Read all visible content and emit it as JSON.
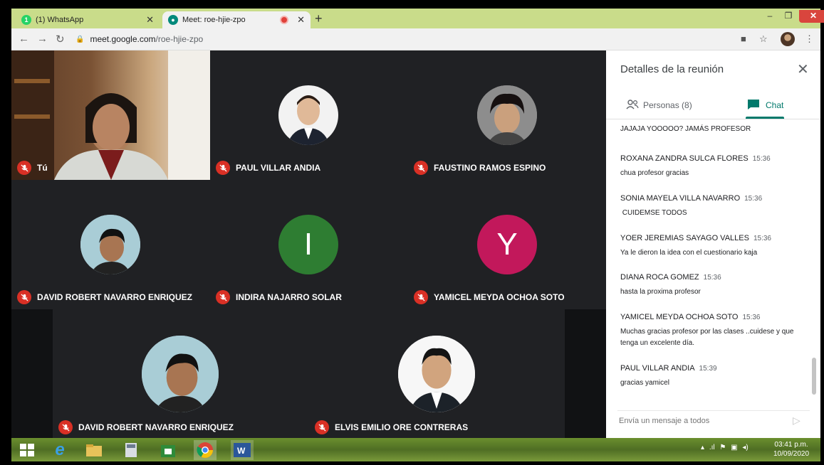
{
  "browser": {
    "tabs": [
      {
        "title": "(1) WhatsApp",
        "favicon": "whatsapp-icon",
        "badge": "1"
      },
      {
        "title": "Meet: roe-hjie-zpo",
        "favicon": "meet-icon"
      }
    ],
    "url_host": "meet.google.com",
    "url_path": "/roe-hjie-zpo",
    "accent": "#c9dc8a"
  },
  "stage": {
    "self_label": "Tú",
    "tiles": [
      {
        "name": "PAUL VILLAR ANDIA"
      },
      {
        "name": "FAUSTINO RAMOS ESPINO"
      },
      {
        "name": "DAVID ROBERT NAVARRO ENRIQUEZ"
      },
      {
        "name": "INDIRA NAJARRO SOLAR",
        "letter": "I",
        "color": "#2e7d32"
      },
      {
        "name": "YAMICEL MEYDA OCHOA SOTO",
        "letter": "Y",
        "color": "#c2185b"
      },
      {
        "name": "DAVID ROBERT NAVARRO ENRIQUEZ"
      },
      {
        "name": "ELVIS EMILIO ORE CONTRERAS"
      }
    ]
  },
  "panel": {
    "title": "Detalles de la reunión",
    "people_tab": "Personas (8)",
    "chat_tab": "Chat",
    "accent": "#00796b",
    "messages": [
      {
        "sender": "",
        "time": "",
        "text": "JAJAJA YOOOOO? JAMÁS PROFESOR"
      },
      {
        "sender": "ROXANA ZANDRA SULCA FLORES",
        "time": "15:36",
        "text": "chua profesor  gracias"
      },
      {
        "sender": "SONIA MAYELA VILLA NAVARRO",
        "time": "15:36",
        "text": " CUIDEMSE TODOS"
      },
      {
        "sender": "YOER JEREMIAS SAYAGO VALLES",
        "time": "15:36",
        "text": "Ya le dieron la idea con el cuestionario kaja"
      },
      {
        "sender": "DIANA ROCA GOMEZ",
        "time": "15:36",
        "text": "hasta la proxima profesor"
      },
      {
        "sender": "YAMICEL MEYDA OCHOA SOTO",
        "time": "15:36",
        "text": "Muchas gracias profesor por las clases ..cuidese y que tenga un excelente día."
      },
      {
        "sender": "PAUL VILLAR ANDIA",
        "time": "15:39",
        "text": "gracias yamicel"
      }
    ],
    "compose_placeholder": "Envía un mensaje a todos"
  },
  "taskbar": {
    "time": "03:41 p.m.",
    "date": "10/09/2020"
  }
}
